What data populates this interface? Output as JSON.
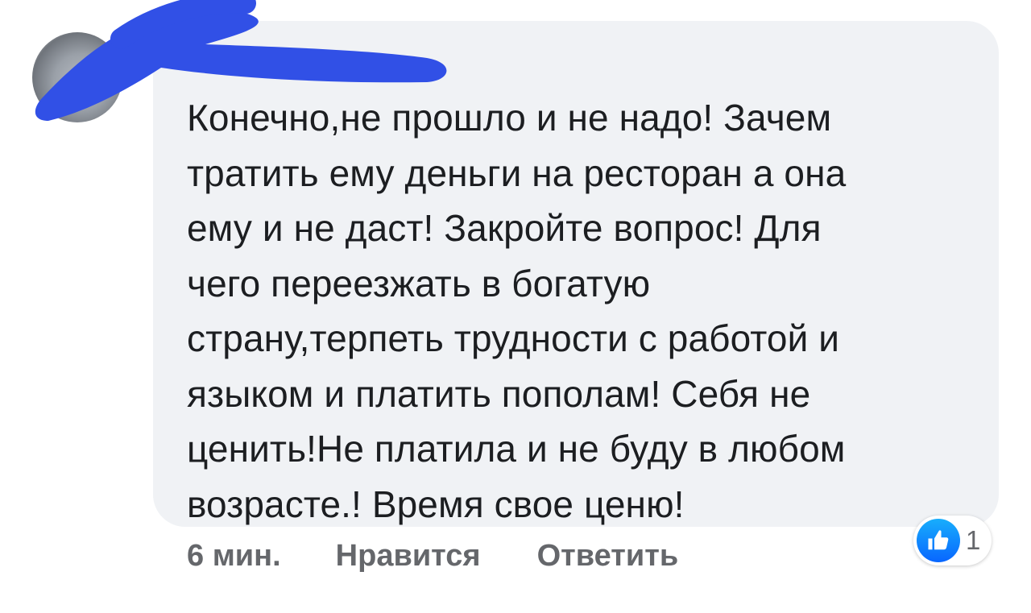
{
  "comment": {
    "lines": [
      "Конечно,не прошло и не надо! Зачем",
      "тратить ему деньги на ресторан а она",
      "ему и не даст! Закройте вопрос! Для",
      "чего переезжать в богатую",
      "страну,терпеть трудности с работой и",
      "языком и платить пополам! Себя не",
      "ценить!Не платила и не буду в любом",
      "возрасте.! Время свое ценю!"
    ]
  },
  "meta": {
    "time": "6 мин.",
    "like_label": "Нравится",
    "reply_label": "Ответить"
  },
  "reactions": {
    "icon": "thumbs-up-icon",
    "count": "1"
  },
  "colors": {
    "bubble": "#f0f2f5",
    "text": "#1c1e21",
    "meta": "#65676b",
    "like_blue": "#0866ff",
    "scribble": "#3150e6"
  }
}
